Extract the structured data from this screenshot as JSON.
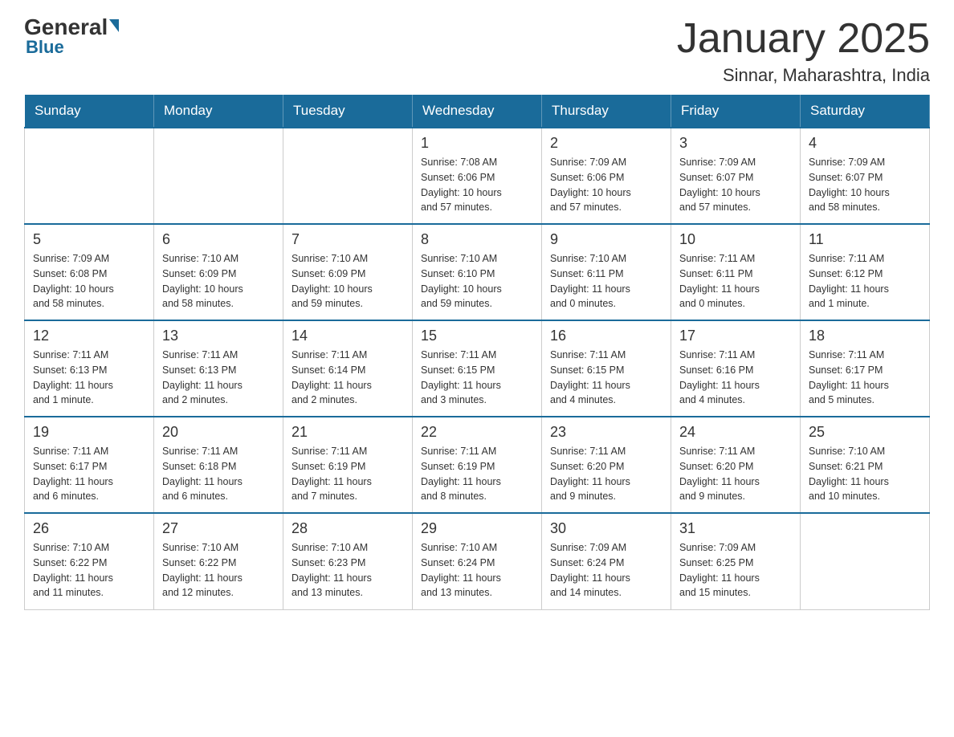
{
  "header": {
    "logo_general": "General",
    "logo_blue": "Blue",
    "title": "January 2025",
    "subtitle": "Sinnar, Maharashtra, India"
  },
  "days_of_week": [
    "Sunday",
    "Monday",
    "Tuesday",
    "Wednesday",
    "Thursday",
    "Friday",
    "Saturday"
  ],
  "weeks": [
    [
      {
        "day": "",
        "info": ""
      },
      {
        "day": "",
        "info": ""
      },
      {
        "day": "",
        "info": ""
      },
      {
        "day": "1",
        "info": "Sunrise: 7:08 AM\nSunset: 6:06 PM\nDaylight: 10 hours\nand 57 minutes."
      },
      {
        "day": "2",
        "info": "Sunrise: 7:09 AM\nSunset: 6:06 PM\nDaylight: 10 hours\nand 57 minutes."
      },
      {
        "day": "3",
        "info": "Sunrise: 7:09 AM\nSunset: 6:07 PM\nDaylight: 10 hours\nand 57 minutes."
      },
      {
        "day": "4",
        "info": "Sunrise: 7:09 AM\nSunset: 6:07 PM\nDaylight: 10 hours\nand 58 minutes."
      }
    ],
    [
      {
        "day": "5",
        "info": "Sunrise: 7:09 AM\nSunset: 6:08 PM\nDaylight: 10 hours\nand 58 minutes."
      },
      {
        "day": "6",
        "info": "Sunrise: 7:10 AM\nSunset: 6:09 PM\nDaylight: 10 hours\nand 58 minutes."
      },
      {
        "day": "7",
        "info": "Sunrise: 7:10 AM\nSunset: 6:09 PM\nDaylight: 10 hours\nand 59 minutes."
      },
      {
        "day": "8",
        "info": "Sunrise: 7:10 AM\nSunset: 6:10 PM\nDaylight: 10 hours\nand 59 minutes."
      },
      {
        "day": "9",
        "info": "Sunrise: 7:10 AM\nSunset: 6:11 PM\nDaylight: 11 hours\nand 0 minutes."
      },
      {
        "day": "10",
        "info": "Sunrise: 7:11 AM\nSunset: 6:11 PM\nDaylight: 11 hours\nand 0 minutes."
      },
      {
        "day": "11",
        "info": "Sunrise: 7:11 AM\nSunset: 6:12 PM\nDaylight: 11 hours\nand 1 minute."
      }
    ],
    [
      {
        "day": "12",
        "info": "Sunrise: 7:11 AM\nSunset: 6:13 PM\nDaylight: 11 hours\nand 1 minute."
      },
      {
        "day": "13",
        "info": "Sunrise: 7:11 AM\nSunset: 6:13 PM\nDaylight: 11 hours\nand 2 minutes."
      },
      {
        "day": "14",
        "info": "Sunrise: 7:11 AM\nSunset: 6:14 PM\nDaylight: 11 hours\nand 2 minutes."
      },
      {
        "day": "15",
        "info": "Sunrise: 7:11 AM\nSunset: 6:15 PM\nDaylight: 11 hours\nand 3 minutes."
      },
      {
        "day": "16",
        "info": "Sunrise: 7:11 AM\nSunset: 6:15 PM\nDaylight: 11 hours\nand 4 minutes."
      },
      {
        "day": "17",
        "info": "Sunrise: 7:11 AM\nSunset: 6:16 PM\nDaylight: 11 hours\nand 4 minutes."
      },
      {
        "day": "18",
        "info": "Sunrise: 7:11 AM\nSunset: 6:17 PM\nDaylight: 11 hours\nand 5 minutes."
      }
    ],
    [
      {
        "day": "19",
        "info": "Sunrise: 7:11 AM\nSunset: 6:17 PM\nDaylight: 11 hours\nand 6 minutes."
      },
      {
        "day": "20",
        "info": "Sunrise: 7:11 AM\nSunset: 6:18 PM\nDaylight: 11 hours\nand 6 minutes."
      },
      {
        "day": "21",
        "info": "Sunrise: 7:11 AM\nSunset: 6:19 PM\nDaylight: 11 hours\nand 7 minutes."
      },
      {
        "day": "22",
        "info": "Sunrise: 7:11 AM\nSunset: 6:19 PM\nDaylight: 11 hours\nand 8 minutes."
      },
      {
        "day": "23",
        "info": "Sunrise: 7:11 AM\nSunset: 6:20 PM\nDaylight: 11 hours\nand 9 minutes."
      },
      {
        "day": "24",
        "info": "Sunrise: 7:11 AM\nSunset: 6:20 PM\nDaylight: 11 hours\nand 9 minutes."
      },
      {
        "day": "25",
        "info": "Sunrise: 7:10 AM\nSunset: 6:21 PM\nDaylight: 11 hours\nand 10 minutes."
      }
    ],
    [
      {
        "day": "26",
        "info": "Sunrise: 7:10 AM\nSunset: 6:22 PM\nDaylight: 11 hours\nand 11 minutes."
      },
      {
        "day": "27",
        "info": "Sunrise: 7:10 AM\nSunset: 6:22 PM\nDaylight: 11 hours\nand 12 minutes."
      },
      {
        "day": "28",
        "info": "Sunrise: 7:10 AM\nSunset: 6:23 PM\nDaylight: 11 hours\nand 13 minutes."
      },
      {
        "day": "29",
        "info": "Sunrise: 7:10 AM\nSunset: 6:24 PM\nDaylight: 11 hours\nand 13 minutes."
      },
      {
        "day": "30",
        "info": "Sunrise: 7:09 AM\nSunset: 6:24 PM\nDaylight: 11 hours\nand 14 minutes."
      },
      {
        "day": "31",
        "info": "Sunrise: 7:09 AM\nSunset: 6:25 PM\nDaylight: 11 hours\nand 15 minutes."
      },
      {
        "day": "",
        "info": ""
      }
    ]
  ]
}
